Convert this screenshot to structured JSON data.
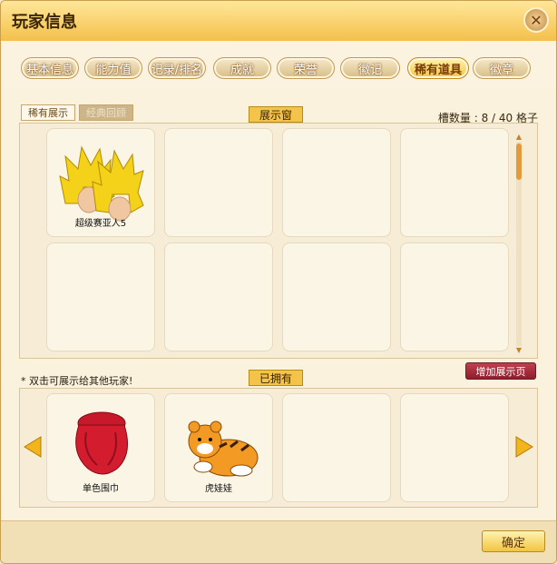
{
  "window": {
    "title": "玩家信息",
    "close_icon": "close-icon"
  },
  "tabs": [
    {
      "label": "基本信息",
      "active": false
    },
    {
      "label": "能力值",
      "active": false
    },
    {
      "label": "记录/排名",
      "active": false
    },
    {
      "label": "成就",
      "active": false
    },
    {
      "label": "荣誉",
      "active": false
    },
    {
      "label": "徽记",
      "active": false
    },
    {
      "label": "稀有道具",
      "active": true
    },
    {
      "label": "徽章",
      "active": false
    }
  ],
  "subtabs": [
    {
      "label": "稀有展示",
      "active": true
    },
    {
      "label": "经典回顾",
      "active": false
    }
  ],
  "showcase": {
    "label": "展示窗",
    "slot_count": "槽数量 : 8 / 40 格子",
    "items": [
      {
        "name": "超级赛亚人5",
        "icon": "super-saiyan-hair-icon"
      }
    ]
  },
  "owned": {
    "label": "已拥有",
    "hint": "* 双击可展示给其他玩家!",
    "items": [
      {
        "name": "单色围巾",
        "icon": "red-scarf-icon"
      },
      {
        "name": "虎娃娃",
        "icon": "tiger-doll-icon"
      }
    ]
  },
  "buttons": {
    "add_page": "增加展示页",
    "confirm": "确定"
  },
  "colors": {
    "accent": "#f3c34a",
    "active_tab": "#f2c442",
    "add_button": "#a02a38"
  }
}
